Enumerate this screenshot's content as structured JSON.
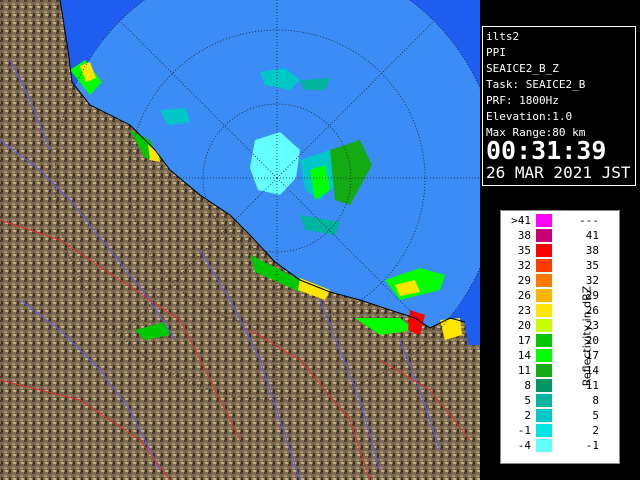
{
  "station": "ilts2",
  "product": "PPI",
  "scan_name": "SEAICE2_B_Z",
  "task": "Task: SEAICE2_B",
  "prf": "PRF: 1800Hz",
  "elevation": "Elevation:1.0",
  "max_range": "Max Range:80 km",
  "time": "00:31:39",
  "date": "26 MAR 2021 JST",
  "legend": {
    "title": "Reflectivity in dBZ",
    "rows": [
      {
        "low": ">41",
        "high": "---",
        "color": "#ff00ff"
      },
      {
        "low": "38",
        "high": "41",
        "color": "#c80078"
      },
      {
        "low": "35",
        "high": "38",
        "color": "#ff0000"
      },
      {
        "low": "32",
        "high": "35",
        "color": "#ff3c00"
      },
      {
        "low": "29",
        "high": "32",
        "color": "#ff7800"
      },
      {
        "low": "26",
        "high": "29",
        "color": "#ffb400"
      },
      {
        "low": "23",
        "high": "26",
        "color": "#ffe600"
      },
      {
        "low": "20",
        "high": "23",
        "color": "#c8ff00"
      },
      {
        "low": "17",
        "high": "20",
        "color": "#00c800"
      },
      {
        "low": "14",
        "high": "17",
        "color": "#00ff00"
      },
      {
        "low": "11",
        "high": "14",
        "color": "#14aa14"
      },
      {
        "low": "8",
        "high": "11",
        "color": "#009664"
      },
      {
        "low": "5",
        "high": "8",
        "color": "#00b4a0"
      },
      {
        "low": "2",
        "high": "5",
        "color": "#00c8c8"
      },
      {
        "low": "-1",
        "high": "2",
        "color": "#00e6e6"
      },
      {
        "low": "-4",
        "high": "-1",
        "color": "#64ffff"
      }
    ]
  },
  "colors": {
    "sea": "#1f5cf0",
    "radar_sea": "#3b8cf5",
    "land": "#7a6850",
    "river": "#5a5aff",
    "boundary": "#e03030"
  }
}
